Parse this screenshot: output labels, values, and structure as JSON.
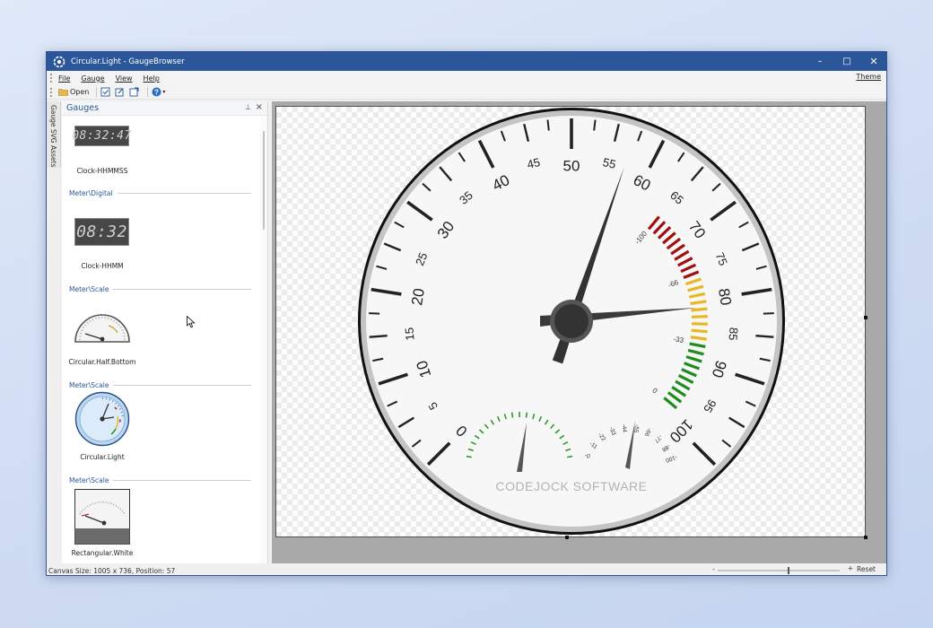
{
  "window": {
    "title": "Circular.Light - GaugeBrowser",
    "minimize_glyph": "–",
    "maximize_glyph": "□",
    "close_glyph": "✕"
  },
  "menu": {
    "items": [
      "File",
      "Gauge",
      "View",
      "Help"
    ],
    "theme": "Theme"
  },
  "toolbar": {
    "open_label": "Open",
    "icons": [
      "folder-open-icon",
      "checklist-icon",
      "edit-icon",
      "export-icon",
      "help-icon"
    ]
  },
  "side_tab": {
    "label": "Gauge SVG Assets"
  },
  "panel": {
    "title": "Gauges",
    "pin_glyph": "📌",
    "close_glyph": "×",
    "items": [
      {
        "header": "",
        "label": "Clock-HHMMSS",
        "digits": "08:32:47"
      },
      {
        "header": "Meter\\Digital",
        "label": "Clock-HHMM",
        "digits": "08:32"
      },
      {
        "header": "Meter\\Scale",
        "label": "Circular.Half.Bottom"
      },
      {
        "header": "Meter\\Scale",
        "label": "Circular.Light"
      },
      {
        "header": "Meter\\Scale",
        "label": "Rectangular.White"
      }
    ]
  },
  "gauge": {
    "main_ticks": [
      0,
      5,
      10,
      15,
      20,
      25,
      30,
      35,
      40,
      45,
      50,
      55,
      60,
      65,
      70,
      75,
      80,
      85,
      90,
      95,
      100
    ],
    "inner_ticks": [
      "-100",
      "-66",
      "-33",
      "0"
    ],
    "small_ticks": [
      "-0",
      "-11",
      "-22",
      "-33",
      "-44",
      "-55",
      "-66",
      "-77",
      "-88",
      "-100"
    ],
    "needle_value": 57,
    "brand": "CODEJOCK  SOFTWARE",
    "colors": {
      "red": "#a01010",
      "yellow": "#e8b81e",
      "green": "#1e8c1e",
      "needle": "#3a3a3a",
      "arc": "#2e9a2e"
    }
  },
  "status": {
    "canvas_info": "Canvas Size: 1005 x 736, Position: 57",
    "zoom_minus": "-",
    "zoom_plus": "+",
    "reset": "Reset"
  }
}
